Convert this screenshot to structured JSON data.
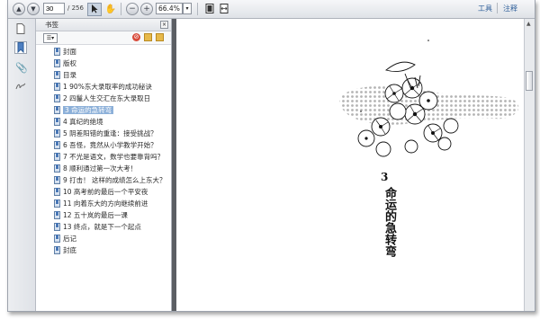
{
  "toolbar": {
    "page_current": "30",
    "page_total": "/ 256",
    "zoom": "66.4%",
    "tools_label": "工具",
    "comment_label": "注释"
  },
  "panel": {
    "title": "书签"
  },
  "bookmarks": [
    {
      "label": "封面"
    },
    {
      "label": "版权"
    },
    {
      "label": "目录"
    },
    {
      "label": "1 90%东大录取率的成功秘诀"
    },
    {
      "label": "2 四鬣人生交汇在东大录取日"
    },
    {
      "label": "3 命运的急转弯"
    },
    {
      "label": "4 真纪的绝境"
    },
    {
      "label": "5 阴差阳错的重逢：接受挑战？"
    },
    {
      "label": "6 吾怪，竟然从小学教学开始？"
    },
    {
      "label": "7 不光是语文，数学也要靠背吗？"
    },
    {
      "label": "8 顺利通过第一次大考！"
    },
    {
      "label": "9 打击！ 这样的成绩怎么上东大？"
    },
    {
      "label": "10 高考前的最后一个平安夜"
    },
    {
      "label": "11 向着东大的方向继续前进"
    },
    {
      "label": "12 五十岚的最后一课"
    },
    {
      "label": "13 终点，就是下一个起点"
    },
    {
      "label": "后记"
    },
    {
      "label": "封底"
    }
  ],
  "selected_index": 5,
  "document": {
    "chapter_number": "3",
    "chapter_title": "命运的急转弯"
  }
}
